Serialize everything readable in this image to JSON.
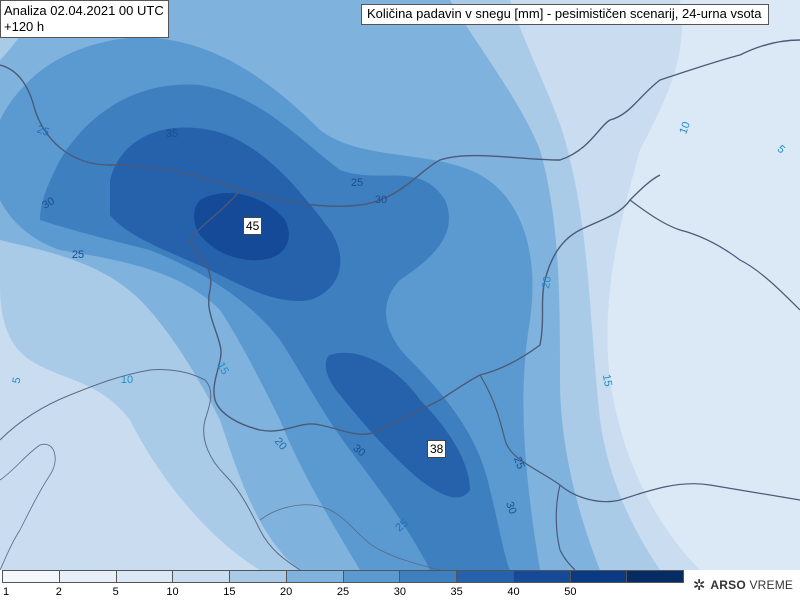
{
  "header": {
    "analysis_line1": "Analiza 02.04.2021 00 UTC",
    "analysis_line2": "+120 h",
    "title": "Količina padavin v snegu [mm] - pesimističen scenarij, 24-urna vsota"
  },
  "max_labels": [
    {
      "id": "max-northwest",
      "value": "45"
    },
    {
      "id": "max-southeast",
      "value": "38"
    }
  ],
  "contour_labels": [
    "25",
    "35",
    "25",
    "30",
    "30",
    "25",
    "10",
    "5",
    "20",
    "15",
    "5",
    "10",
    "15",
    "20",
    "30",
    "25",
    "30",
    "25"
  ],
  "legend": {
    "ticks": [
      "1",
      "2",
      "5",
      "10",
      "15",
      "20",
      "25",
      "30",
      "35",
      "40",
      "50"
    ],
    "colors": [
      "#f4f8fd",
      "#e7f0f9",
      "#dbe8f5",
      "#c9dcf0",
      "#a9cbe7",
      "#7fb2dc",
      "#5b9ad0",
      "#3e7fc0",
      "#2661ab",
      "#154a98",
      "#0b3a84",
      "#062c66"
    ]
  },
  "logo": {
    "icon": "snowflake-icon",
    "brand": "ARSO",
    "text": "VREME"
  }
}
